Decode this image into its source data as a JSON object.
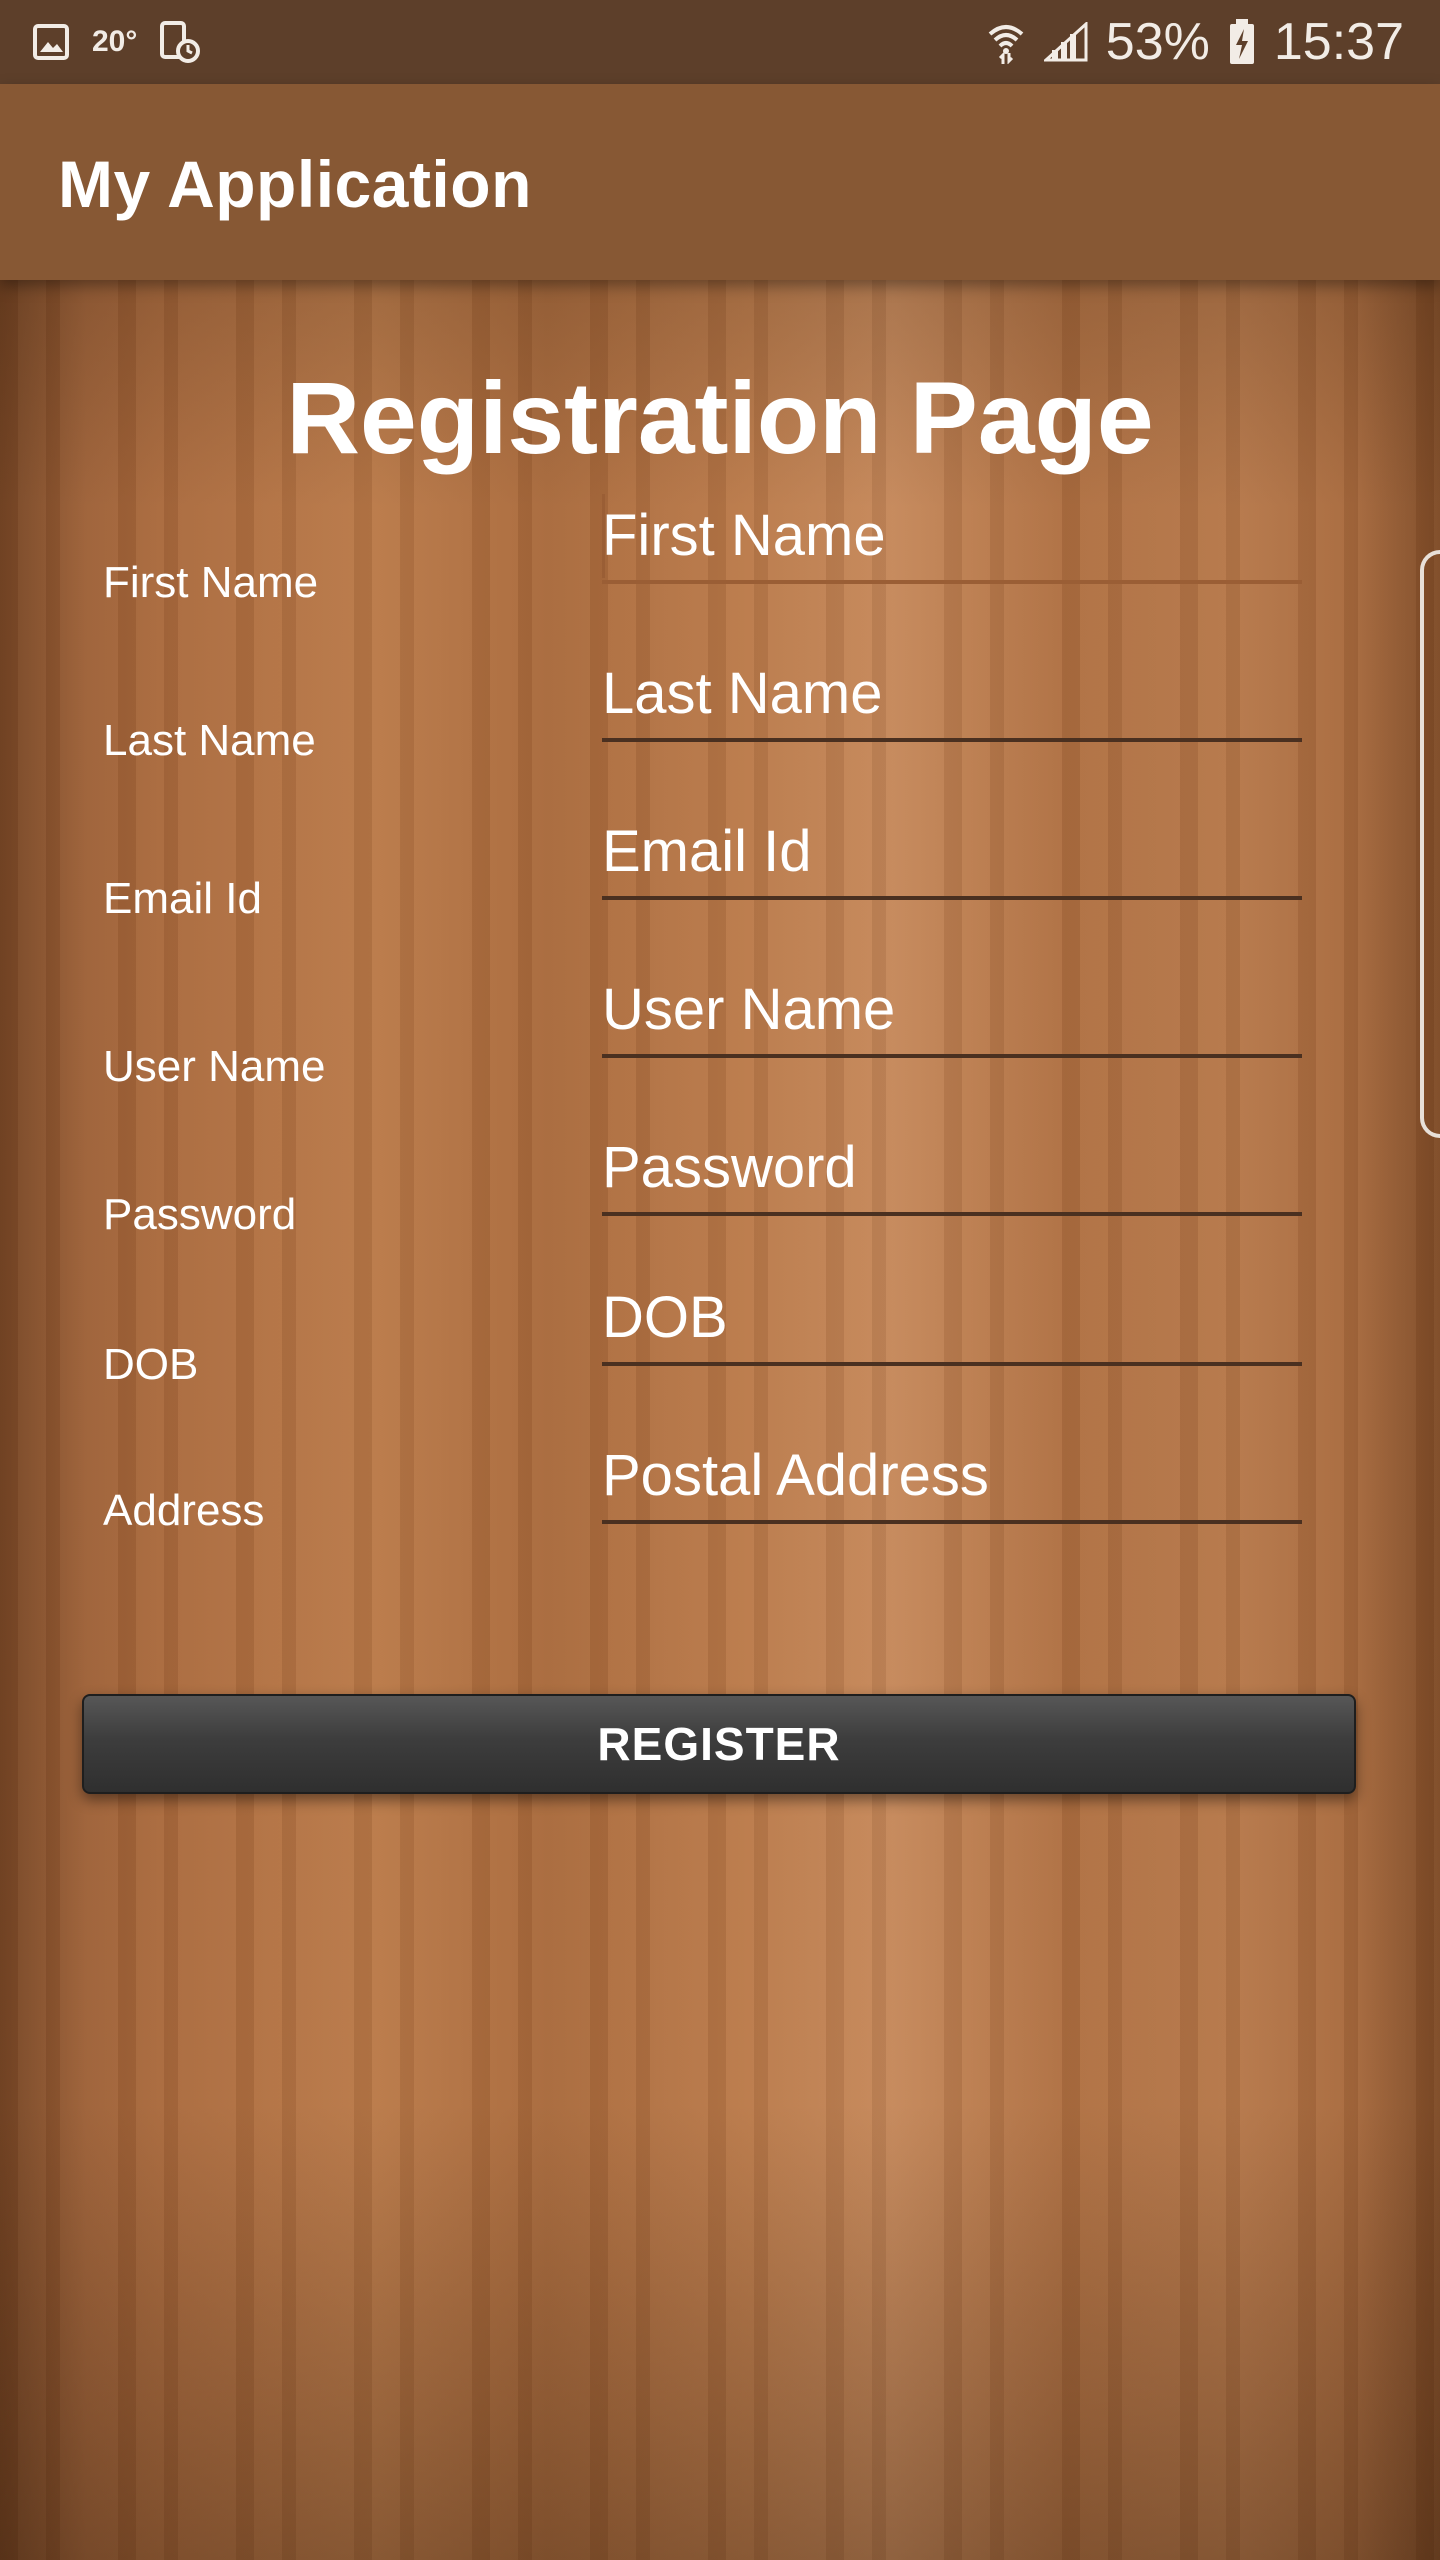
{
  "status_bar": {
    "temperature": "20°",
    "battery": "53%",
    "time": "15:37",
    "icons": [
      "gallery-icon",
      "screen-record-icon",
      "wifi-icon",
      "signal-icon",
      "battery-charging-icon"
    ]
  },
  "app_bar": {
    "title": "My Application"
  },
  "form": {
    "title": "Registration Page",
    "labels": [
      "First Name",
      "Last Name",
      "Email Id",
      "User Name",
      "Password",
      "DOB",
      "Address"
    ],
    "placeholders": [
      "First Name",
      "Last Name",
      "Email Id",
      "User Name",
      "Password",
      "DOB",
      "Postal Address"
    ],
    "values": [
      "",
      "",
      "",
      "",
      "",
      "",
      ""
    ],
    "focused_field": "First Name",
    "register_label": "REGISTER"
  },
  "colors": {
    "status_bar": "#5d3f2a",
    "app_bar": "#875834",
    "underline": "#4a3020",
    "focus_underline": "#9a5e35",
    "button": "#3d3d3d",
    "text": "#ffffff"
  }
}
